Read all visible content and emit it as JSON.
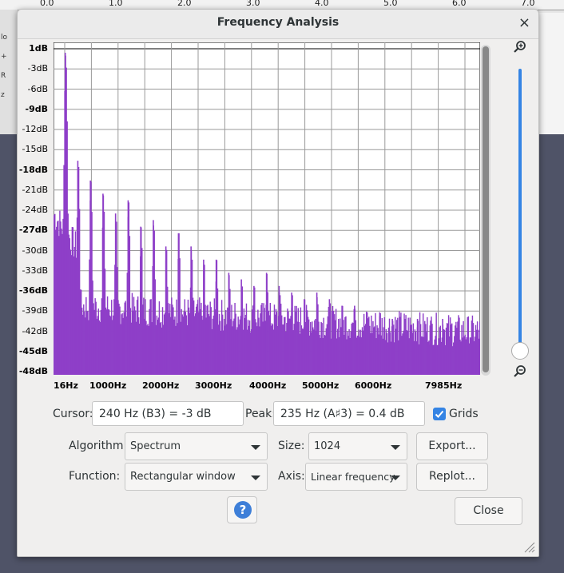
{
  "background": {
    "ruler_ticks": [
      "0.0",
      "1.0",
      "2.0",
      "3.0",
      "4.0",
      "5.0",
      "6.0",
      "7.0"
    ],
    "left_labels": [
      "lo",
      "+",
      "R",
      "z"
    ]
  },
  "dialog": {
    "title": "Frequency Analysis",
    "close_glyph": "×"
  },
  "chart_data": {
    "type": "area",
    "y_labels": [
      "1dB",
      "-3dB",
      "-6dB",
      "-9dB",
      "-12dB",
      "-15dB",
      "-18dB",
      "-21dB",
      "-24dB",
      "-27dB",
      "-30dB",
      "-33dB",
      "-36dB",
      "-39dB",
      "-42dB",
      "-45dB",
      "-48dB"
    ],
    "x_labels": [
      "16Hz",
      "1000Hz",
      "2000Hz",
      "3000Hz",
      "4000Hz",
      "5000Hz",
      "6000Hz",
      "7985Hz"
    ],
    "ylim": [
      -49,
      1
    ],
    "xlim": [
      16,
      7985
    ],
    "grid": true,
    "color": "#8e3fc8",
    "peaks": [
      {
        "x": 235,
        "y": 0.4
      },
      {
        "x": 470,
        "y": -16
      },
      {
        "x": 705,
        "y": -19
      },
      {
        "x": 940,
        "y": -21
      },
      {
        "x": 1175,
        "y": -24
      },
      {
        "x": 1410,
        "y": -22
      },
      {
        "x": 1645,
        "y": -26
      },
      {
        "x": 1880,
        "y": -25
      },
      {
        "x": 2115,
        "y": -29
      },
      {
        "x": 2350,
        "y": -27
      },
      {
        "x": 2585,
        "y": -29
      },
      {
        "x": 2820,
        "y": -31
      },
      {
        "x": 3055,
        "y": -31
      },
      {
        "x": 3290,
        "y": -33
      },
      {
        "x": 3525,
        "y": -34
      },
      {
        "x": 3760,
        "y": -35
      },
      {
        "x": 3995,
        "y": -33
      },
      {
        "x": 4230,
        "y": -35
      },
      {
        "x": 4465,
        "y": -36
      },
      {
        "x": 4700,
        "y": -37
      },
      {
        "x": 4935,
        "y": -36
      },
      {
        "x": 5170,
        "y": -37
      },
      {
        "x": 5405,
        "y": -38
      },
      {
        "x": 5640,
        "y": -38
      },
      {
        "x": 5875,
        "y": -39
      },
      {
        "x": 6110,
        "y": -39
      },
      {
        "x": 6345,
        "y": -40
      },
      {
        "x": 6580,
        "y": -40
      },
      {
        "x": 6815,
        "y": -40
      },
      {
        "x": 7050,
        "y": -41
      },
      {
        "x": 7285,
        "y": -40
      },
      {
        "x": 7520,
        "y": -41
      },
      {
        "x": 7755,
        "y": -40
      }
    ]
  },
  "controls": {
    "cursor_label": "Cursor:",
    "cursor_value": "240 Hz (B3) = -3 dB",
    "peak_label": "Peak:",
    "peak_value": "235 Hz (A♯3) = 0.4 dB",
    "grids_label": "Grids",
    "grids_checked": true,
    "algorithm_label": "Algorithm:",
    "algorithm_value": "Spectrum",
    "size_label": "Size:",
    "size_value": "1024",
    "function_label": "Function:",
    "function_value": "Rectangular window",
    "axis_label": "Axis:",
    "axis_value": "Linear frequency",
    "export_label": "Export...",
    "replot_label": "Replot...",
    "help_glyph": "?",
    "close_label": "Close"
  },
  "icons": {
    "zoom_in": "zoom-in-icon",
    "zoom_out": "zoom-out-icon",
    "help": "help-icon",
    "check": "checkmark-icon"
  }
}
